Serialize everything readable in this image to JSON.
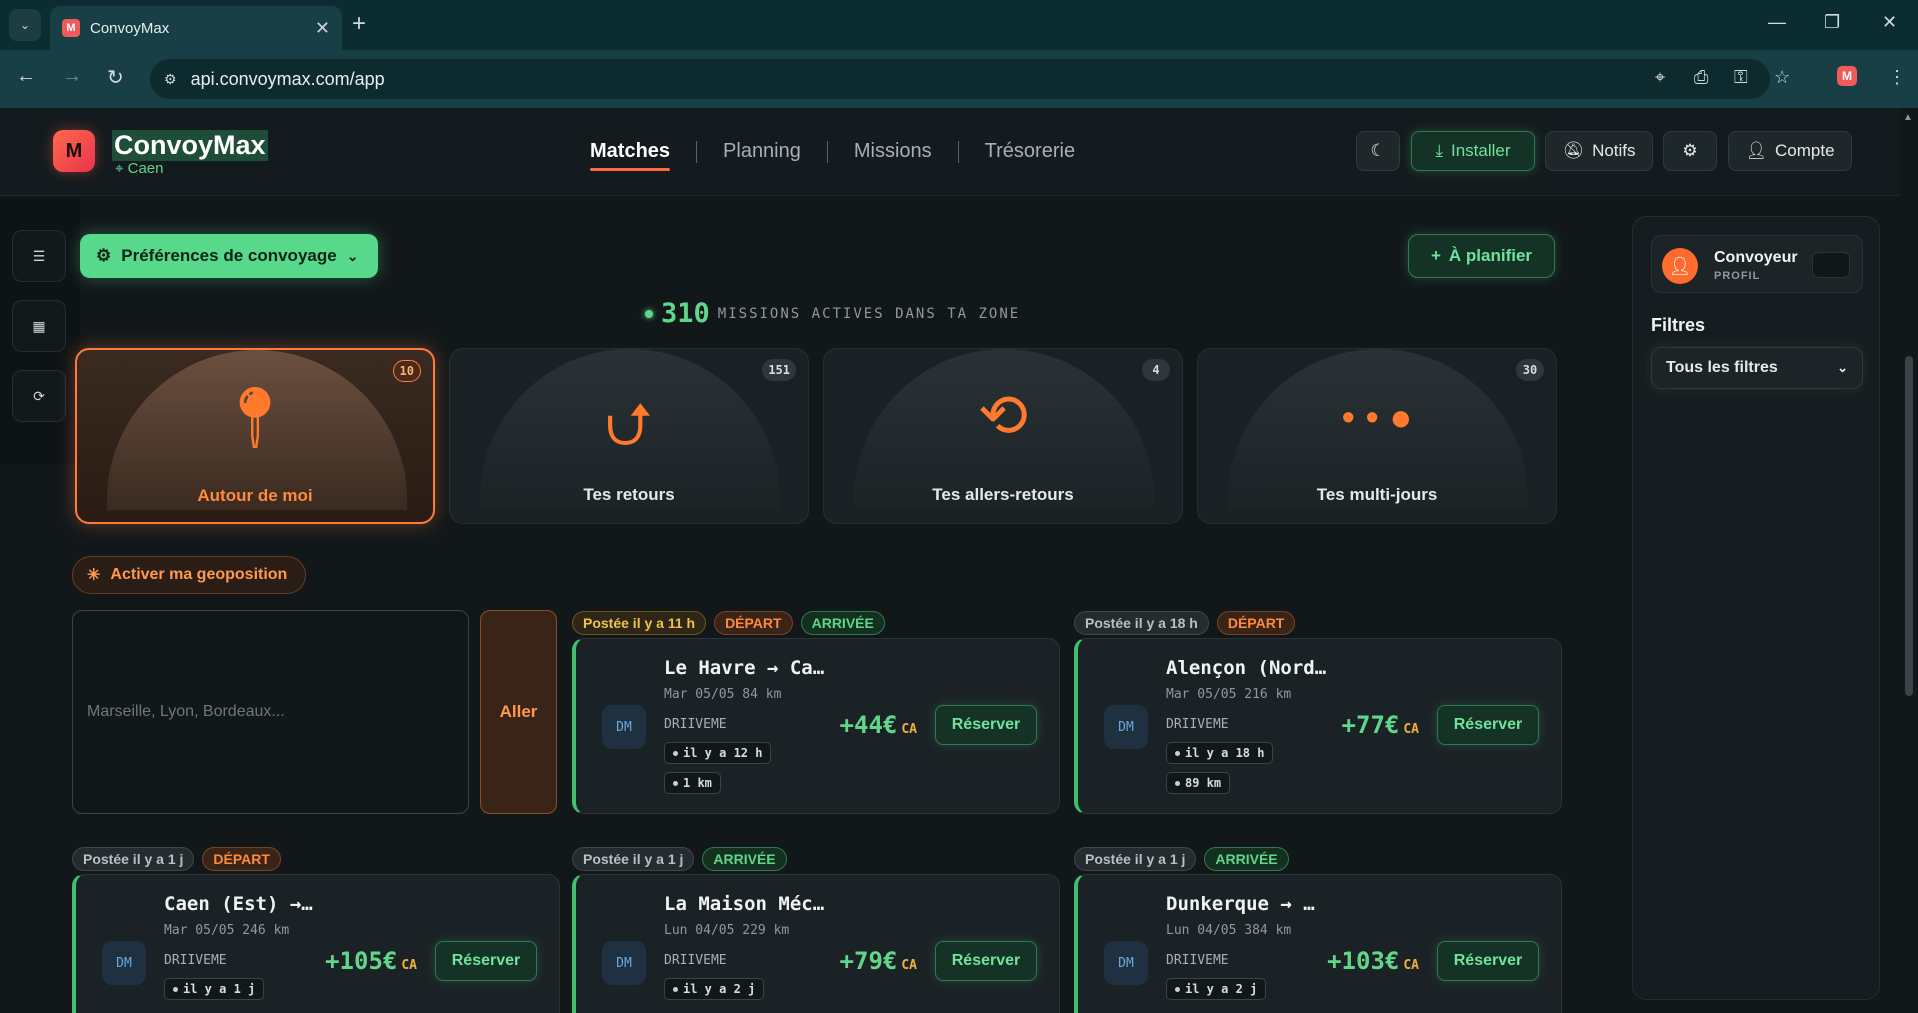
{
  "browser": {
    "tab_title": "ConvoyMax",
    "tab_favicon": "M",
    "url": "api.convoymax.com/app"
  },
  "header": {
    "logo_letter": "M",
    "brand": "ConvoyMax",
    "city": "Caen",
    "nav": [
      "Matches",
      "Planning",
      "Missions",
      "Trésorerie"
    ],
    "theme_icon": "moon-icon",
    "install_label": "Installer",
    "notifs_label": "Notifs",
    "account_label": "Compte"
  },
  "toolbar": {
    "prefs_label": "Préférences de convoyage",
    "plan_label": "À planifier",
    "active_count": "310",
    "active_label": "MISSIONS ACTIVES DANS TA ZONE"
  },
  "categories": [
    {
      "label": "Autour de moi",
      "count": "10",
      "icon": "map-pin-icon"
    },
    {
      "label": "Tes retours",
      "count": "151",
      "icon": "u-turn-icon"
    },
    {
      "label": "Tes allers-retours",
      "count": "4",
      "icon": "loop-arrows-icon"
    },
    {
      "label": "Tes multi-jours",
      "count": "30",
      "icon": "multi-pin-icon"
    }
  ],
  "geo_label": "Activer ma geoposition",
  "search": {
    "placeholder": "Marseille, Lyon, Bordeaux...",
    "go_label": "Aller"
  },
  "missions": [
    {
      "posted": "Postée il y a 11 h",
      "dep": "DÉPART",
      "arr": "ARRIVÉE",
      "route": "Le Havre → Ca…",
      "meta": "Mar 05/05 84 km",
      "company": "DRIIVEME",
      "avatar": "DM",
      "chip1": "il y a 12 h",
      "chip2": "1 km",
      "price": "+44€",
      "unit": "CA",
      "reserve": "Réserver"
    },
    {
      "posted": "Postée il y a 18 h",
      "dep": "DÉPART",
      "route": "Alençon (Nord…",
      "meta": "Mar 05/05 216 km",
      "company": "DRIIVEME",
      "avatar": "DM",
      "chip1": "il y a 18 h",
      "chip2": "89 km",
      "price": "+77€",
      "unit": "CA",
      "reserve": "Réserver"
    },
    {
      "posted": "Postée il y a 1 j",
      "dep": "DÉPART",
      "route": "Caen (Est) →…",
      "meta": "Mar 05/05 246 km",
      "company": "DRIIVEME",
      "avatar": "DM",
      "chip1": "il y a 1 j",
      "price": "+105€",
      "unit": "CA",
      "reserve": "Réserver"
    },
    {
      "posted": "Postée il y a 1 j",
      "arr": "ARRIVÉE",
      "route": "La Maison Méc…",
      "meta": "Lun 04/05 229 km",
      "company": "DRIIVEME",
      "avatar": "DM",
      "chip1": "il y a 2 j",
      "price": "+79€",
      "unit": "CA",
      "reserve": "Réserver"
    },
    {
      "posted": "Postée il y a 1 j",
      "arr": "ARRIVÉE",
      "route": "Dunkerque → …",
      "meta": "Lun 04/05 384 km",
      "company": "DRIIVEME",
      "avatar": "DM",
      "chip1": "il y a 2 j",
      "price": "+103€",
      "unit": "CA",
      "reserve": "Réserver"
    }
  ],
  "sidebar": {
    "profile_name": "Convoyeur",
    "profile_role": "PROFIL",
    "filters_title": "Filtres",
    "filters_select": "Tous les filtres"
  }
}
